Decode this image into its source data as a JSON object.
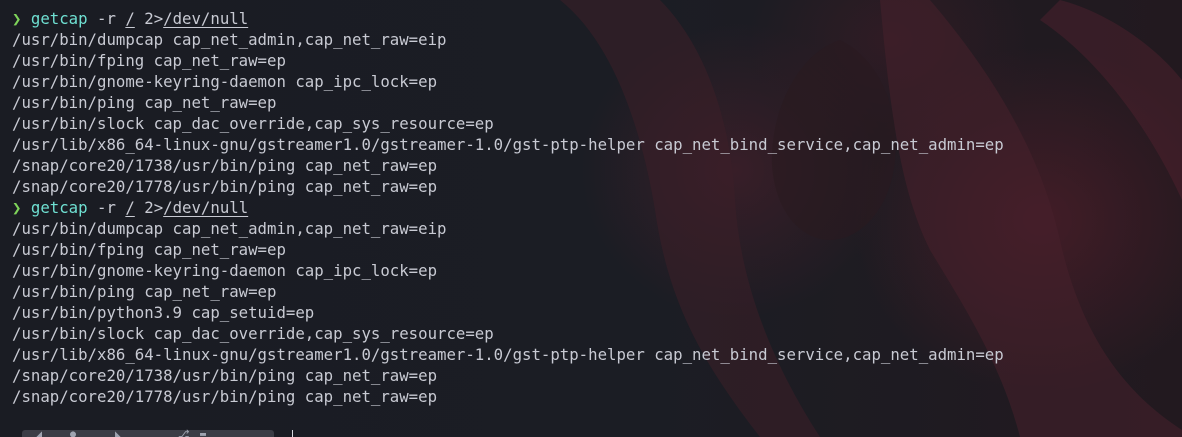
{
  "session": [
    {
      "prompt_symbol": "❯",
      "command": "getcap",
      "args": [
        " -r ",
        "/",
        " 2>",
        "/dev/null"
      ],
      "output": [
        "/usr/bin/dumpcap cap_net_admin,cap_net_raw=eip",
        "/usr/bin/fping cap_net_raw=ep",
        "/usr/bin/gnome-keyring-daemon cap_ipc_lock=ep",
        "/usr/bin/ping cap_net_raw=ep",
        "/usr/bin/slock cap_dac_override,cap_sys_resource=ep",
        "/usr/lib/x86_64-linux-gnu/gstreamer1.0/gstreamer-1.0/gst-ptp-helper cap_net_bind_service,cap_net_admin=ep",
        "/snap/core20/1738/usr/bin/ping cap_net_raw=ep",
        "/snap/core20/1778/usr/bin/ping cap_net_raw=ep"
      ]
    },
    {
      "prompt_symbol": "❯",
      "command": "getcap",
      "args": [
        " -r ",
        "/",
        " 2>",
        "/dev/null"
      ],
      "output": [
        "/usr/bin/dumpcap cap_net_admin,cap_net_raw=eip",
        "/usr/bin/fping cap_net_raw=ep",
        "/usr/bin/gnome-keyring-daemon cap_ipc_lock=ep",
        "/usr/bin/ping cap_net_raw=ep",
        "/usr/bin/python3.9 cap_setuid=ep",
        "/usr/bin/slock cap_dac_override,cap_sys_resource=ep",
        "/usr/lib/x86_64-linux-gnu/gstreamer1.0/gstreamer-1.0/gst-ptp-helper cap_net_bind_service,cap_net_admin=ep",
        "/snap/core20/1738/usr/bin/ping cap_net_raw=ep",
        "/snap/core20/1778/usr/bin/ping cap_net_raw=ep"
      ]
    }
  ],
  "colors": {
    "background": "#1b1d24",
    "text": "#c8cad3",
    "prompt": "#7ed35a",
    "command": "#6fe0d2"
  },
  "icons": {
    "prompt": "chevron-right-icon",
    "background": "wallpaper-art"
  }
}
